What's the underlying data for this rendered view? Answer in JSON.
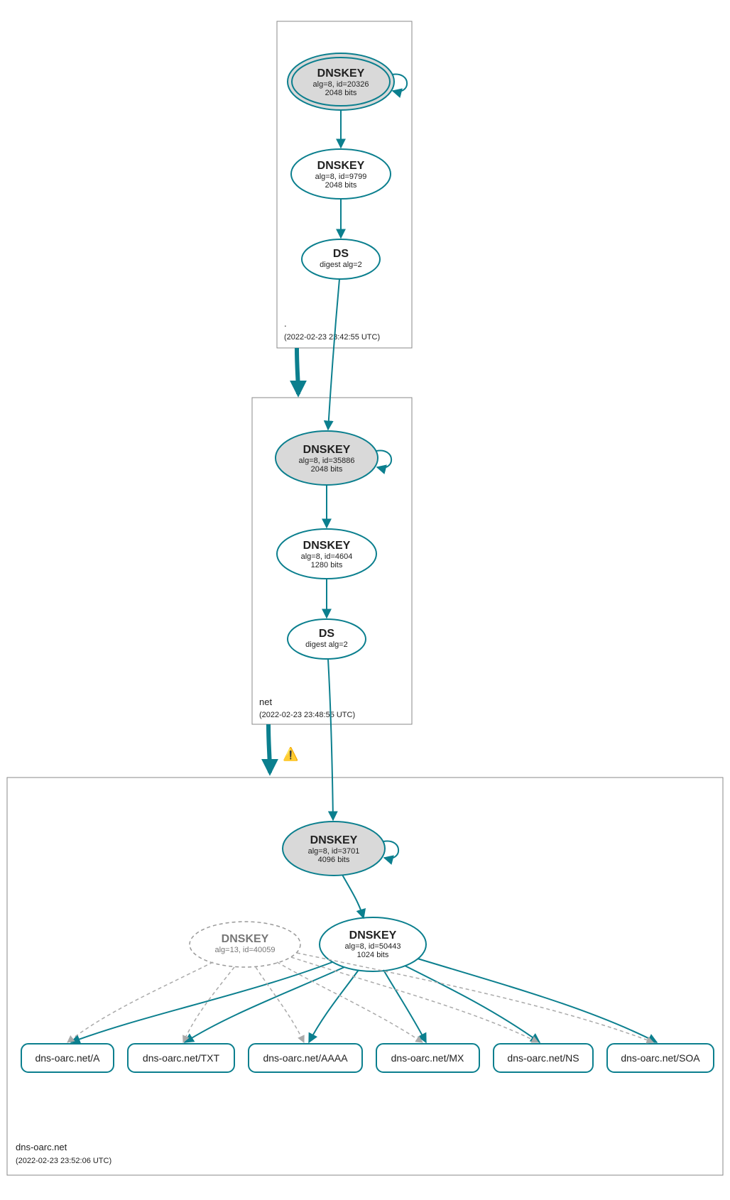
{
  "zones": {
    "root": {
      "name": ".",
      "timestamp": "(2022-02-23 23:42:55 UTC)"
    },
    "net": {
      "name": "net",
      "timestamp": "(2022-02-23 23:48:55 UTC)"
    },
    "dnsoarc": {
      "name": "dns-oarc.net",
      "timestamp": "(2022-02-23 23:52:06 UTC)"
    }
  },
  "nodes": {
    "root_ksk": {
      "title": "DNSKEY",
      "line1": "alg=8, id=20326",
      "line2": "2048 bits"
    },
    "root_zsk": {
      "title": "DNSKEY",
      "line1": "alg=8, id=9799",
      "line2": "2048 bits"
    },
    "root_ds": {
      "title": "DS",
      "line1": "digest alg=2"
    },
    "net_ksk": {
      "title": "DNSKEY",
      "line1": "alg=8, id=35886",
      "line2": "2048 bits"
    },
    "net_zsk": {
      "title": "DNSKEY",
      "line1": "alg=8, id=4604",
      "line2": "1280 bits"
    },
    "net_ds": {
      "title": "DS",
      "line1": "digest alg=2"
    },
    "dnsoarc_ksk": {
      "title": "DNSKEY",
      "line1": "alg=8, id=3701",
      "line2": "4096 bits"
    },
    "dnsoarc_zsk": {
      "title": "DNSKEY",
      "line1": "alg=8, id=50443",
      "line2": "1024 bits"
    },
    "dnsoarc_extra": {
      "title": "DNSKEY",
      "line1": "alg=13, id=40059"
    }
  },
  "rrsets": {
    "a": "dns-oarc.net/A",
    "txt": "dns-oarc.net/TXT",
    "aaaa": "dns-oarc.net/AAAA",
    "mx": "dns-oarc.net/MX",
    "ns": "dns-oarc.net/NS",
    "soa": "dns-oarc.net/SOA"
  },
  "warning_icon": "⚠"
}
